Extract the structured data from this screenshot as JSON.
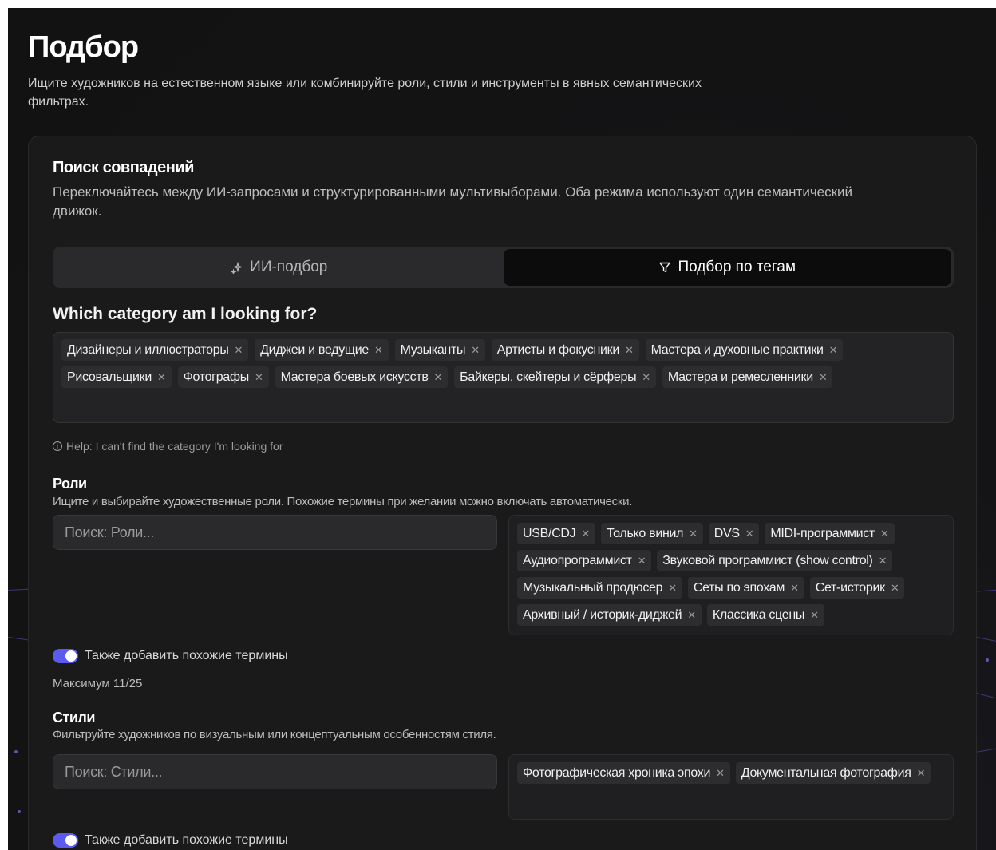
{
  "header": {
    "title": "Подбор",
    "subtitle": "Ищите художников на естественном языке или комбинируйте роли, стили и инструменты в явных семантических фильтрах."
  },
  "card": {
    "title": "Поиск совпадений",
    "description": "Переключайтесь между ИИ-запросами и структурированными мультивыборами. Оба режима используют один семантический движок.",
    "modes": [
      {
        "label": "ИИ-подбор",
        "icon": "sparkle-icon",
        "active": false
      },
      {
        "label": "Подбор по тегам",
        "icon": "filter-icon",
        "active": true
      }
    ]
  },
  "categories": {
    "question": "Which category am I looking for?",
    "chips": [
      "Дизайнеры и иллюстраторы",
      "Диджеи и ведущие",
      "Музыканты",
      "Артисты и фокусники",
      "Мастера и духовные практики",
      "Рисовальщики",
      "Фотографы",
      "Мастера боевых искусств",
      "Байкеры, скейтеры и сёрферы",
      "Мастера и ремесленники"
    ],
    "help": "Help: I can't find the category I'm looking for"
  },
  "roles": {
    "title": "Роли",
    "description": "Ищите и выбирайте художественные роли. Похожие термины при желании можно включать автоматически.",
    "placeholder": "Поиск: Роли...",
    "chips": [
      "USB/CDJ",
      "Только винил",
      "DVS",
      "MIDI-программист",
      "Аудиопрограммист",
      "Звуковой программист (show control)",
      "Музыкальный продюсер",
      "Сеты по эпохам",
      "Сет-историк",
      "Архивный / историк-диджей",
      "Классика сцены"
    ],
    "toggle_label": "Также добавить похожие термины",
    "max_note": "Максимум 11/25"
  },
  "styles": {
    "title": "Стили",
    "description": "Фильтруйте художников по визуальным или концептуальным особенностям стиля.",
    "placeholder": "Поиск: Стили...",
    "chips": [
      "Фотографическая хроника эпохи",
      "Документальная фотография"
    ],
    "toggle_label": "Также добавить похожие термины"
  },
  "colors": {
    "accent": "#5b5bf0",
    "background": "#121212",
    "card": "#1a1a1b"
  }
}
